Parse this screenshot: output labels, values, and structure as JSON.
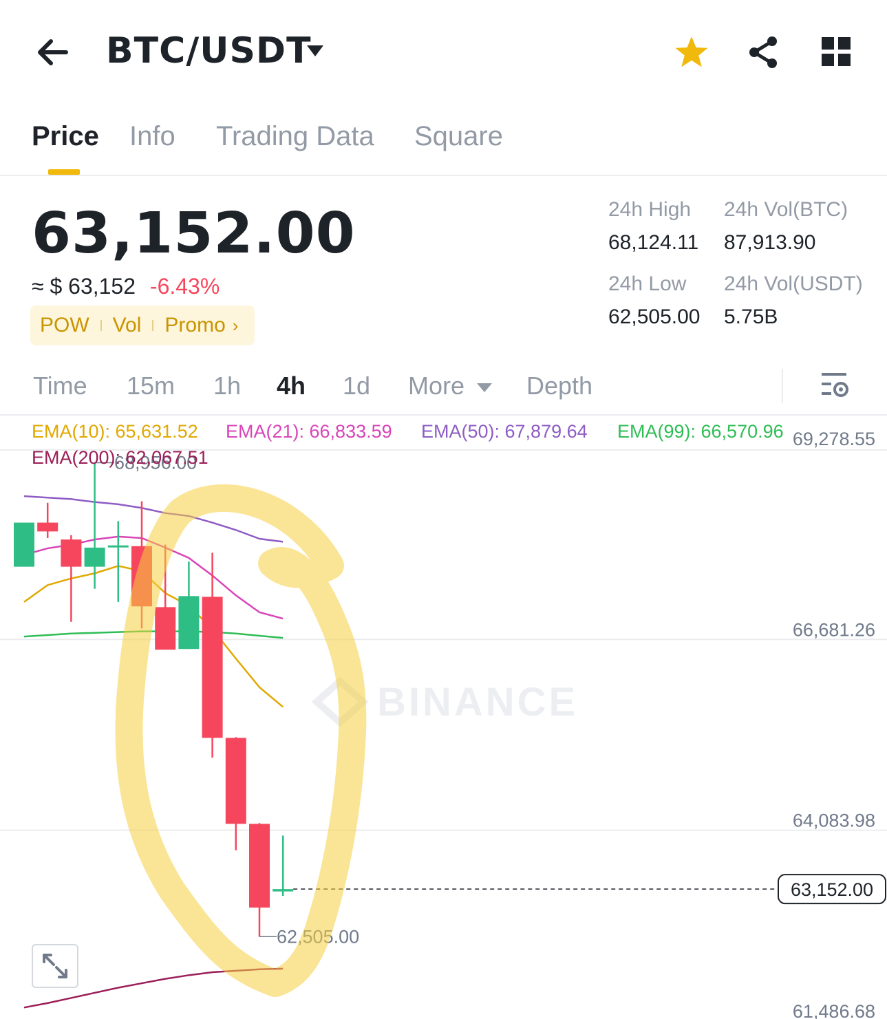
{
  "header": {
    "pair": "BTC/USDT",
    "icons": [
      "back-arrow-icon",
      "caret-down-icon",
      "star-icon",
      "share-icon",
      "grid-icon"
    ],
    "favorite_color": "#f0b90b"
  },
  "tabs": [
    {
      "label": "Price",
      "active": true
    },
    {
      "label": "Info",
      "active": false
    },
    {
      "label": "Trading Data",
      "active": false
    },
    {
      "label": "Square",
      "active": false
    }
  ],
  "ticker": {
    "last_price": "63,152.00",
    "approx_prefix": "≈ $",
    "approx_usd": "63,152",
    "change": "-6.43%",
    "tags": [
      "POW",
      "Vol",
      "Promo"
    ],
    "stats": {
      "high_label": "24h High",
      "high_value": "68,124.11",
      "vol_btc_label": "24h Vol(BTC)",
      "vol_btc_value": "87,913.90",
      "low_label": "24h Low",
      "low_value": "62,505.00",
      "vol_usdt_label": "24h Vol(USDT)",
      "vol_usdt_value": "5.75B"
    }
  },
  "timeframes": {
    "items": [
      "Time",
      "15m",
      "1h",
      "4h",
      "1d",
      "More",
      "Depth"
    ],
    "selected": "4h"
  },
  "chart": {
    "ema": [
      {
        "label": "EMA(10): 65,631.52",
        "color": "#e0a800"
      },
      {
        "label": "EMA(21): 66,833.59",
        "color": "#d944b8"
      },
      {
        "label": "EMA(50): 67,879.64",
        "color": "#8e5cc4"
      },
      {
        "label": "EMA(99): 66,570.96",
        "color": "#2ebd55"
      },
      {
        "label": "EMA(200): 62,067.51",
        "color": "#9b1e58"
      }
    ],
    "price_ticks": [
      "69,278.55",
      "66,681.26",
      "64,083.98",
      "61,486.68"
    ],
    "high_marker": "68,956.00",
    "low_marker": "62,505.00",
    "last_price_label": "63,152.00",
    "watermark": "BINANCE",
    "up_color": "#2ebd85",
    "down_color": "#f6465d",
    "highlight_color": "#f5d03f"
  },
  "chart_data": {
    "type": "candlestick",
    "interval": "4h",
    "y_ticks": [
      69278.55,
      66681.26,
      64083.98,
      61486.68
    ],
    "candles": [
      {
        "o": 67540,
        "h": 68060,
        "c": 68140,
        "l": 67540,
        "dir": "up"
      },
      {
        "o": 68140,
        "h": 68410,
        "c": 68020,
        "l": 67930,
        "dir": "down"
      },
      {
        "o": 67910,
        "h": 67970,
        "c": 67540,
        "l": 66790,
        "dir": "down"
      },
      {
        "o": 67540,
        "h": 68956,
        "c": 67800,
        "l": 67240,
        "dir": "up"
      },
      {
        "o": 67810,
        "h": 68160,
        "c": 67830,
        "l": 67060,
        "dir": "up"
      },
      {
        "o": 67820,
        "h": 68430,
        "c": 67000,
        "l": 66700,
        "dir": "down"
      },
      {
        "o": 66990,
        "h": 67840,
        "c": 66410,
        "l": 66620,
        "dir": "down"
      },
      {
        "o": 66420,
        "h": 67610,
        "c": 67140,
        "l": 66420,
        "dir": "up"
      },
      {
        "o": 67130,
        "h": 67730,
        "c": 65210,
        "l": 64940,
        "dir": "down"
      },
      {
        "o": 65210,
        "h": 65220,
        "c": 64040,
        "l": 63680,
        "dir": "down"
      },
      {
        "o": 64040,
        "h": 64050,
        "c": 62900,
        "l": 62505,
        "dir": "down"
      },
      {
        "o": 63120,
        "h": 63880,
        "c": 63152,
        "l": 63060,
        "dir": "up"
      }
    ],
    "ema_series": [
      {
        "name": "EMA(10)",
        "values": [
          67060,
          67290,
          67380,
          67450,
          67550,
          67480,
          67180,
          67010,
          66690,
          66290,
          65900,
          65631
        ]
      },
      {
        "name": "EMA(21)",
        "values": [
          67700,
          67790,
          67840,
          67910,
          67950,
          67930,
          67800,
          67660,
          67420,
          67150,
          66920,
          66834
        ]
      },
      {
        "name": "EMA(50)",
        "values": [
          68500,
          68480,
          68460,
          68420,
          68390,
          68340,
          68270,
          68230,
          68140,
          68040,
          67920,
          67880
        ]
      },
      {
        "name": "EMA(99)",
        "values": [
          66590,
          66610,
          66630,
          66640,
          66650,
          66660,
          66660,
          66660,
          66650,
          66630,
          66600,
          66571
        ]
      },
      {
        "name": "EMA(200)",
        "values": [
          61540,
          61600,
          61670,
          61740,
          61810,
          61870,
          61930,
          61980,
          62020,
          62040,
          62060,
          62068
        ]
      }
    ]
  }
}
